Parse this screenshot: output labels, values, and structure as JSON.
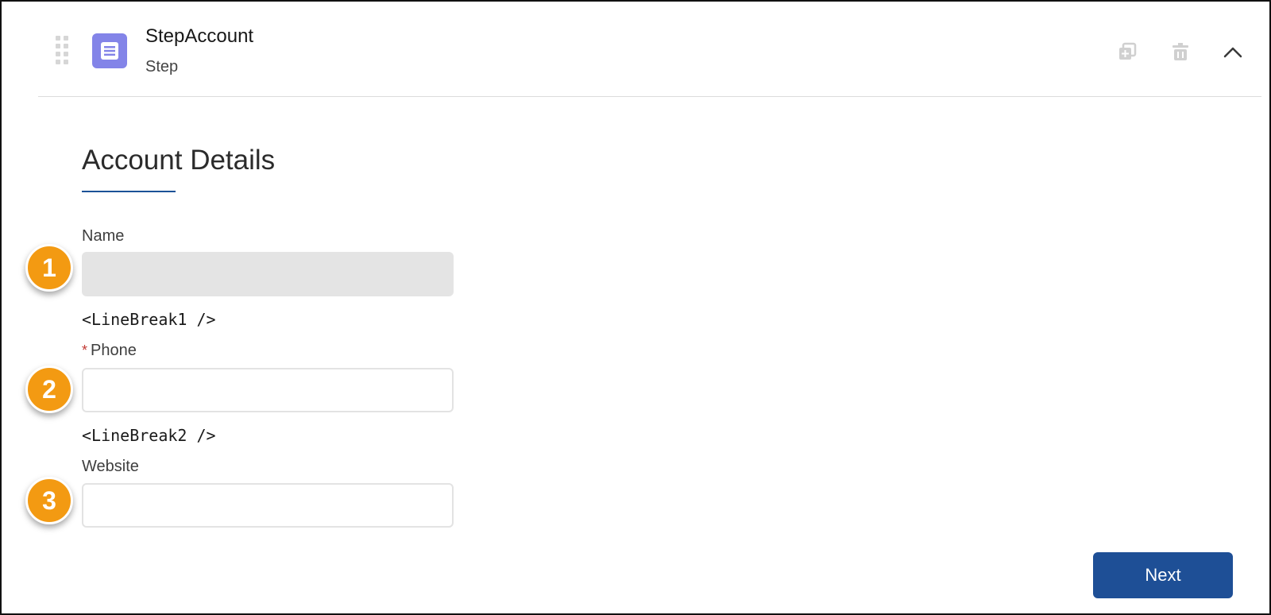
{
  "header": {
    "title": "StepAccount",
    "subtitle": "Step",
    "icons": {
      "drag": "drag-handle-icon",
      "step": "list-icon",
      "duplicate": "duplicate-icon",
      "delete": "trash-icon",
      "collapse": "chevron-up-icon"
    }
  },
  "section": {
    "title": "Account Details"
  },
  "fields": {
    "name": {
      "label": "Name",
      "value": "",
      "badge": "1"
    },
    "linebreak1": "<LineBreak1 />",
    "phone": {
      "required_marker": "*",
      "label": "Phone",
      "value": "",
      "badge": "2"
    },
    "linebreak2": "<LineBreak2 />",
    "website": {
      "label": "Website",
      "value": "",
      "badge": "3"
    }
  },
  "footer": {
    "next_label": "Next"
  },
  "colors": {
    "step_icon": "#8384e8",
    "badge": "#f39a12",
    "primary_button": "#1e4f96",
    "section_underline": "#1b5297",
    "required": "#c23934"
  }
}
